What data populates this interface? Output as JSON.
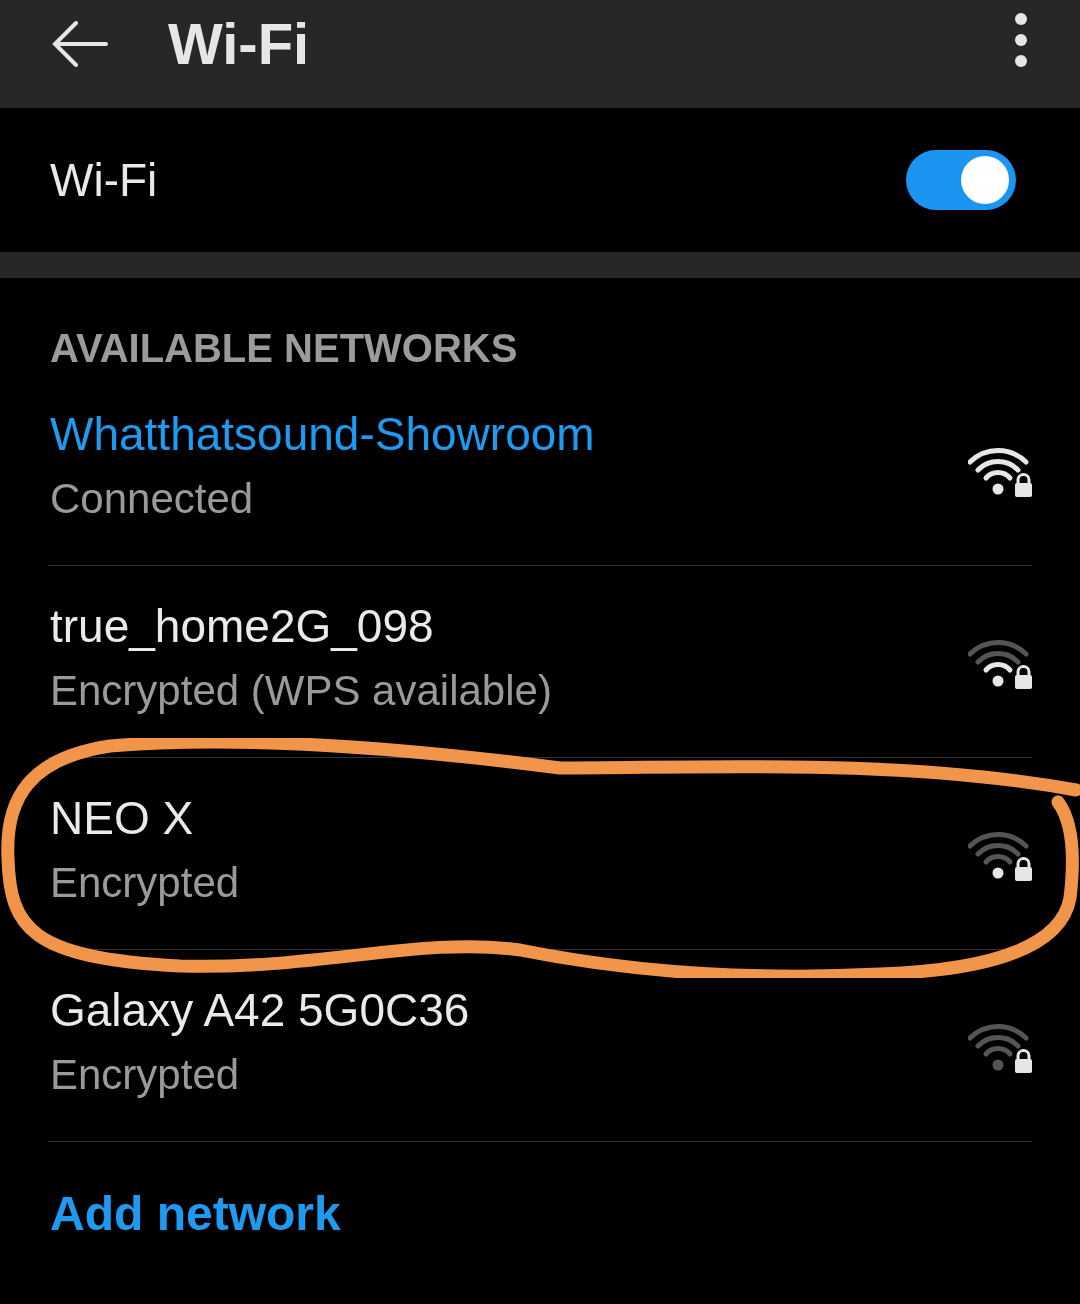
{
  "header": {
    "title": "Wi-Fi"
  },
  "wifi_toggle": {
    "label": "Wi-Fi",
    "on": true
  },
  "section_title": "AVAILABLE NETWORKS",
  "networks": [
    {
      "name": "Whatthatsound-Showroom",
      "status": "Connected",
      "connected": true,
      "kind": "strong",
      "highlighted": false
    },
    {
      "name": "true_home2G_098",
      "status": "Encrypted (WPS available)",
      "connected": false,
      "kind": "fair",
      "highlighted": false
    },
    {
      "name": "NEO X",
      "status": "Encrypted",
      "connected": false,
      "kind": "weak",
      "highlighted": true
    },
    {
      "name": "Galaxy A42 5G0C36",
      "status": "Encrypted",
      "connected": false,
      "kind": "faint",
      "highlighted": false
    }
  ],
  "add_network": "Add network"
}
